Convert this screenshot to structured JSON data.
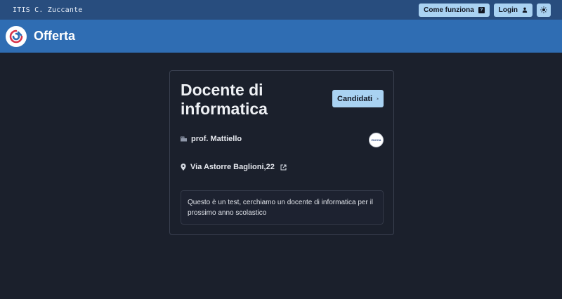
{
  "topbar": {
    "brand": "ITIS C. Zuccante",
    "how_it_works_label": "Come funziona",
    "login_label": "Login"
  },
  "header": {
    "title": "Offerta"
  },
  "offer": {
    "title": "Docente di informatica",
    "apply_label": "Candidati",
    "professor": "prof. Mattiello",
    "address": "Via Astorre Baglioni,22",
    "school_logo_text": "ZUCCA",
    "description": "Questo è un test, cerchiamo un docente di informatica per il prossimo anno scolastico"
  },
  "colors": {
    "topbar_bg": "#284d7e",
    "header_bg": "#2f6db3",
    "page_bg": "#1b202c",
    "button_bg": "#a9d2f2"
  },
  "icons": [
    "help-icon",
    "user-icon",
    "theme-toggle-icon",
    "app-logo-icon",
    "apply-icon",
    "professor-icon",
    "location-pin-icon",
    "external-link-icon",
    "school-logo"
  ]
}
